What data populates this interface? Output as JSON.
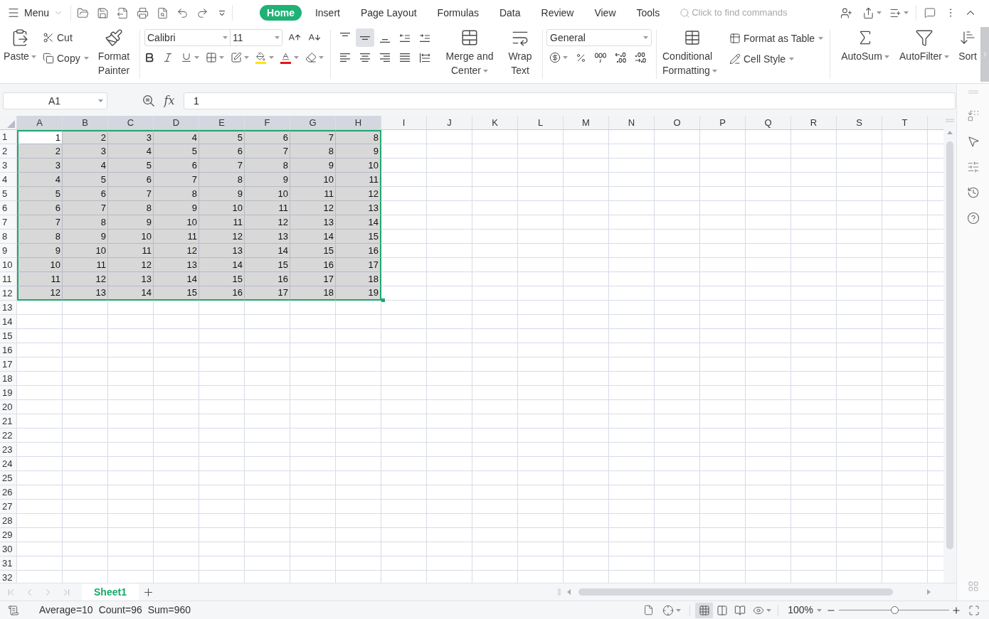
{
  "top_bar": {
    "menu_label": "Menu",
    "tabs": [
      {
        "label": "Home",
        "selected": true
      },
      {
        "label": "Insert",
        "selected": false
      },
      {
        "label": "Page Layout",
        "selected": false
      },
      {
        "label": "Formulas",
        "selected": false
      },
      {
        "label": "Data",
        "selected": false
      },
      {
        "label": "Review",
        "selected": false
      },
      {
        "label": "View",
        "selected": false
      },
      {
        "label": "Tools",
        "selected": false
      }
    ],
    "search": {
      "placeholder": "Click to find commands"
    }
  },
  "ribbon": {
    "clipboard": {
      "paste": "Paste",
      "cut": "Cut",
      "copy": "Copy",
      "format_painter": "Format Painter"
    },
    "font": {
      "name": "Calibri",
      "size": "11"
    },
    "alignment": [
      {
        "kind": "top",
        "selected": false
      },
      {
        "kind": "middle",
        "selected": true
      },
      {
        "kind": "bottom",
        "selected": false
      },
      {
        "kind": "indent_decrease",
        "selected": false
      },
      {
        "kind": "indent_increase",
        "selected": false
      },
      {
        "kind": "left",
        "selected": false
      },
      {
        "kind": "center",
        "selected": false
      },
      {
        "kind": "right",
        "selected": false
      },
      {
        "kind": "justify",
        "selected": false
      },
      {
        "kind": "distributed",
        "selected": false
      }
    ],
    "merge_and_center": "Merge and Center",
    "wrap_text": "Wrap Text",
    "number_format": "General",
    "conditional_formatting": "Conditional Formatting",
    "format_as_table": "Format as Table",
    "cell_style": "Cell Style",
    "autosum": "AutoSum",
    "autofilter": "AutoFilter",
    "sort": "Sort"
  },
  "formula_bar": {
    "name_box": "A1",
    "function_label": "fx",
    "formula": "1"
  },
  "sheet": {
    "columns": [
      {
        "label": "A",
        "selected": true
      },
      {
        "label": "B",
        "selected": true
      },
      {
        "label": "C",
        "selected": true
      },
      {
        "label": "D",
        "selected": true
      },
      {
        "label": "E",
        "selected": true
      },
      {
        "label": "F",
        "selected": true
      },
      {
        "label": "G",
        "selected": true
      },
      {
        "label": "H",
        "selected": true
      },
      {
        "label": "I",
        "selected": false
      },
      {
        "label": "J",
        "selected": false
      },
      {
        "label": "K",
        "selected": false
      },
      {
        "label": "L",
        "selected": false
      },
      {
        "label": "M",
        "selected": false
      },
      {
        "label": "N",
        "selected": false
      },
      {
        "label": "O",
        "selected": false
      },
      {
        "label": "P",
        "selected": false
      },
      {
        "label": "Q",
        "selected": false
      },
      {
        "label": "R",
        "selected": false
      },
      {
        "label": "S",
        "selected": false
      },
      {
        "label": "T",
        "selected": false
      }
    ],
    "rows": [
      {
        "header": "1",
        "cells": [
          {
            "value": "1",
            "selected": true,
            "active": true
          },
          {
            "value": "2",
            "selected": true,
            "active": false
          },
          {
            "value": "3",
            "selected": true,
            "active": false
          },
          {
            "value": "4",
            "selected": true,
            "active": false
          },
          {
            "value": "5",
            "selected": true,
            "active": false
          },
          {
            "value": "6",
            "selected": true,
            "active": false
          },
          {
            "value": "7",
            "selected": true,
            "active": false
          },
          {
            "value": "8",
            "selected": true,
            "active": false
          }
        ]
      },
      {
        "header": "2",
        "cells": [
          {
            "value": "2",
            "selected": true,
            "active": false
          },
          {
            "value": "3",
            "selected": true,
            "active": false
          },
          {
            "value": "4",
            "selected": true,
            "active": false
          },
          {
            "value": "5",
            "selected": true,
            "active": false
          },
          {
            "value": "6",
            "selected": true,
            "active": false
          },
          {
            "value": "7",
            "selected": true,
            "active": false
          },
          {
            "value": "8",
            "selected": true,
            "active": false
          },
          {
            "value": "9",
            "selected": true,
            "active": false
          }
        ]
      },
      {
        "header": "3",
        "cells": [
          {
            "value": "3",
            "selected": true,
            "active": false
          },
          {
            "value": "4",
            "selected": true,
            "active": false
          },
          {
            "value": "5",
            "selected": true,
            "active": false
          },
          {
            "value": "6",
            "selected": true,
            "active": false
          },
          {
            "value": "7",
            "selected": true,
            "active": false
          },
          {
            "value": "8",
            "selected": true,
            "active": false
          },
          {
            "value": "9",
            "selected": true,
            "active": false
          },
          {
            "value": "10",
            "selected": true,
            "active": false
          }
        ]
      },
      {
        "header": "4",
        "cells": [
          {
            "value": "4",
            "selected": true,
            "active": false
          },
          {
            "value": "5",
            "selected": true,
            "active": false
          },
          {
            "value": "6",
            "selected": true,
            "active": false
          },
          {
            "value": "7",
            "selected": true,
            "active": false
          },
          {
            "value": "8",
            "selected": true,
            "active": false
          },
          {
            "value": "9",
            "selected": true,
            "active": false
          },
          {
            "value": "10",
            "selected": true,
            "active": false
          },
          {
            "value": "11",
            "selected": true,
            "active": false
          }
        ]
      },
      {
        "header": "5",
        "cells": [
          {
            "value": "5",
            "selected": true,
            "active": false
          },
          {
            "value": "6",
            "selected": true,
            "active": false
          },
          {
            "value": "7",
            "selected": true,
            "active": false
          },
          {
            "value": "8",
            "selected": true,
            "active": false
          },
          {
            "value": "9",
            "selected": true,
            "active": false
          },
          {
            "value": "10",
            "selected": true,
            "active": false
          },
          {
            "value": "11",
            "selected": true,
            "active": false
          },
          {
            "value": "12",
            "selected": true,
            "active": false
          }
        ]
      },
      {
        "header": "6",
        "cells": [
          {
            "value": "6",
            "selected": true,
            "active": false
          },
          {
            "value": "7",
            "selected": true,
            "active": false
          },
          {
            "value": "8",
            "selected": true,
            "active": false
          },
          {
            "value": "9",
            "selected": true,
            "active": false
          },
          {
            "value": "10",
            "selected": true,
            "active": false
          },
          {
            "value": "11",
            "selected": true,
            "active": false
          },
          {
            "value": "12",
            "selected": true,
            "active": false
          },
          {
            "value": "13",
            "selected": true,
            "active": false
          }
        ]
      },
      {
        "header": "7",
        "cells": [
          {
            "value": "7",
            "selected": true,
            "active": false
          },
          {
            "value": "8",
            "selected": true,
            "active": false
          },
          {
            "value": "9",
            "selected": true,
            "active": false
          },
          {
            "value": "10",
            "selected": true,
            "active": false
          },
          {
            "value": "11",
            "selected": true,
            "active": false
          },
          {
            "value": "12",
            "selected": true,
            "active": false
          },
          {
            "value": "13",
            "selected": true,
            "active": false
          },
          {
            "value": "14",
            "selected": true,
            "active": false
          }
        ]
      },
      {
        "header": "8",
        "cells": [
          {
            "value": "8",
            "selected": true,
            "active": false
          },
          {
            "value": "9",
            "selected": true,
            "active": false
          },
          {
            "value": "10",
            "selected": true,
            "active": false
          },
          {
            "value": "11",
            "selected": true,
            "active": false
          },
          {
            "value": "12",
            "selected": true,
            "active": false
          },
          {
            "value": "13",
            "selected": true,
            "active": false
          },
          {
            "value": "14",
            "selected": true,
            "active": false
          },
          {
            "value": "15",
            "selected": true,
            "active": false
          }
        ]
      },
      {
        "header": "9",
        "cells": [
          {
            "value": "9",
            "selected": true,
            "active": false
          },
          {
            "value": "10",
            "selected": true,
            "active": false
          },
          {
            "value": "11",
            "selected": true,
            "active": false
          },
          {
            "value": "12",
            "selected": true,
            "active": false
          },
          {
            "value": "13",
            "selected": true,
            "active": false
          },
          {
            "value": "14",
            "selected": true,
            "active": false
          },
          {
            "value": "15",
            "selected": true,
            "active": false
          },
          {
            "value": "16",
            "selected": true,
            "active": false
          }
        ]
      },
      {
        "header": "10",
        "cells": [
          {
            "value": "10",
            "selected": true,
            "active": false
          },
          {
            "value": "11",
            "selected": true,
            "active": false
          },
          {
            "value": "12",
            "selected": true,
            "active": false
          },
          {
            "value": "13",
            "selected": true,
            "active": false
          },
          {
            "value": "14",
            "selected": true,
            "active": false
          },
          {
            "value": "15",
            "selected": true,
            "active": false
          },
          {
            "value": "16",
            "selected": true,
            "active": false
          },
          {
            "value": "17",
            "selected": true,
            "active": false
          }
        ]
      },
      {
        "header": "11",
        "cells": [
          {
            "value": "11",
            "selected": true,
            "active": false
          },
          {
            "value": "12",
            "selected": true,
            "active": false
          },
          {
            "value": "13",
            "selected": true,
            "active": false
          },
          {
            "value": "14",
            "selected": true,
            "active": false
          },
          {
            "value": "15",
            "selected": true,
            "active": false
          },
          {
            "value": "16",
            "selected": true,
            "active": false
          },
          {
            "value": "17",
            "selected": true,
            "active": false
          },
          {
            "value": "18",
            "selected": true,
            "active": false
          }
        ]
      },
      {
        "header": "12",
        "cells": [
          {
            "value": "12",
            "selected": true,
            "active": false
          },
          {
            "value": "13",
            "selected": true,
            "active": false
          },
          {
            "value": "14",
            "selected": true,
            "active": false
          },
          {
            "value": "15",
            "selected": true,
            "active": false
          },
          {
            "value": "16",
            "selected": true,
            "active": false
          },
          {
            "value": "17",
            "selected": true,
            "active": false
          },
          {
            "value": "18",
            "selected": true,
            "active": false
          },
          {
            "value": "19",
            "selected": true,
            "active": false
          }
        ]
      },
      {
        "header": "13"
      },
      {
        "header": "14"
      },
      {
        "header": "15"
      },
      {
        "header": "16"
      },
      {
        "header": "17"
      },
      {
        "header": "18"
      },
      {
        "header": "19"
      },
      {
        "header": "20"
      },
      {
        "header": "21"
      },
      {
        "header": "22"
      },
      {
        "header": "23"
      },
      {
        "header": "24"
      },
      {
        "header": "25"
      },
      {
        "header": "26"
      },
      {
        "header": "27"
      },
      {
        "header": "28"
      },
      {
        "header": "29"
      },
      {
        "header": "30"
      },
      {
        "header": "31"
      },
      {
        "header": "32"
      }
    ]
  },
  "sheet_tabs": [
    {
      "label": "Sheet1",
      "selected": true
    }
  ],
  "status_bar": {
    "statistics": [
      "Average=10",
      "Count=96",
      "Sum=960"
    ],
    "view_modes": [
      {
        "kind": "normal",
        "selected": true
      },
      {
        "kind": "page_break",
        "selected": false
      },
      {
        "kind": "reading",
        "selected": false
      }
    ],
    "zoom": {
      "reading": "100%",
      "level": 0.5
    }
  }
}
